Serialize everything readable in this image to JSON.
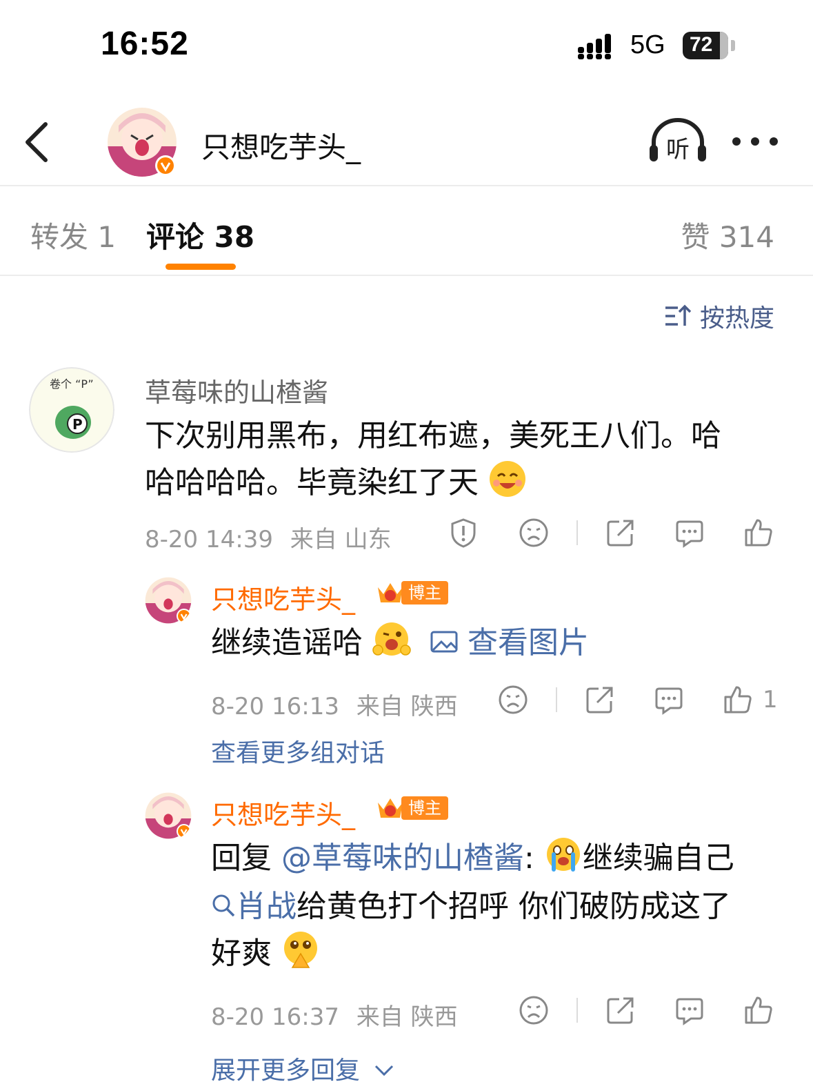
{
  "status_bar": {
    "time": "16:52",
    "network": "5G",
    "battery": "72"
  },
  "header": {
    "username": "只想吃芋头_",
    "listen_label": "听"
  },
  "tabs": {
    "repost": "转发 1",
    "comment": "评论 38",
    "like": "赞 314"
  },
  "sort": {
    "label": "按热度"
  },
  "colors": {
    "accent": "#ff8200",
    "link": "#4a6ea8",
    "verified": "#ff8200"
  },
  "comments": [
    {
      "username": "草莓味的山楂酱",
      "avatar_text": "卷个 “P”",
      "text_line1": "下次别用黑布，用红布遮，美死王八们。哈",
      "text_line2": "哈哈哈哈。毕竟染红了天",
      "meta_time": "8-20 14:39",
      "meta_from": "来自 山东"
    },
    {
      "username": "只想吃芋头_",
      "badge": "博主",
      "text": "继续造谣哈",
      "image_link": "查看图片",
      "meta_time": "8-20 16:13",
      "meta_from": "来自 陕西",
      "like_count": "1",
      "more_link": "查看更多组对话"
    },
    {
      "username": "只想吃芋头_",
      "badge": "博主",
      "reply_prefix": "回复 ",
      "reply_mention": "@草莓味的山楂酱",
      "reply_text": ":",
      "reply_text2": "继续骗自己",
      "topic": "肖战",
      "line2_rest": "给黄色打个招呼 你们破防成这了",
      "line3": "好爽",
      "meta_time": "8-20 16:37",
      "meta_from": "来自 陕西",
      "more_link": "展开更多回复"
    }
  ]
}
